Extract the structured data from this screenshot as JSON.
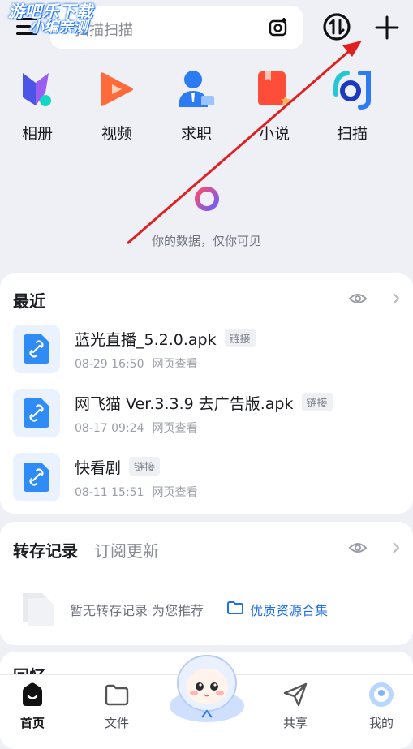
{
  "watermark": {
    "line1": "游吧乐下载",
    "line2": "小编亲测"
  },
  "header": {
    "search_placeholder": "扫描扫描",
    "search_icon": "camera-scan-icon",
    "sync_icon": "transfer-sync-icon",
    "add_icon": "plus-icon"
  },
  "apps": [
    {
      "label": "相册",
      "icon": "album-icon"
    },
    {
      "label": "视频",
      "icon": "video-play-icon"
    },
    {
      "label": "求职",
      "icon": "job-person-icon"
    },
    {
      "label": "小说",
      "icon": "novel-book-icon"
    },
    {
      "label": "扫描",
      "icon": "scan-icon"
    }
  ],
  "privacy": {
    "text": "你的数据，仅你可见"
  },
  "recent": {
    "title": "最近",
    "items": [
      {
        "name": "蓝光直播_5.2.0.apk",
        "tag": "链接",
        "date": "08-29 16:50",
        "source": "网页查看"
      },
      {
        "name": "网飞猫 Ver.3.3.9 去广告版.apk",
        "tag": "链接",
        "date": "08-17 09:24",
        "source": "网页查看"
      },
      {
        "name": "快看剧",
        "tag": "链接",
        "date": "08-11 15:51",
        "source": "网页查看"
      }
    ]
  },
  "transfer": {
    "tab_records": "转存记录",
    "tab_subscribe": "订阅更新",
    "empty_text": "暂无转存记录 为您推荐",
    "recommend_link": "优质资源合集"
  },
  "third_section": {
    "title": "回忆"
  },
  "nav": [
    {
      "label": "首页",
      "icon": "home-icon",
      "active": true
    },
    {
      "label": "文件",
      "icon": "folder-icon",
      "active": false
    },
    {
      "label": "共享",
      "icon": "share-plane-icon",
      "active": false
    },
    {
      "label": "我的",
      "icon": "profile-avatar-icon",
      "active": false
    }
  ],
  "colors": {
    "accent": "#1e6fe8",
    "annotation_arrow": "#e02020"
  }
}
